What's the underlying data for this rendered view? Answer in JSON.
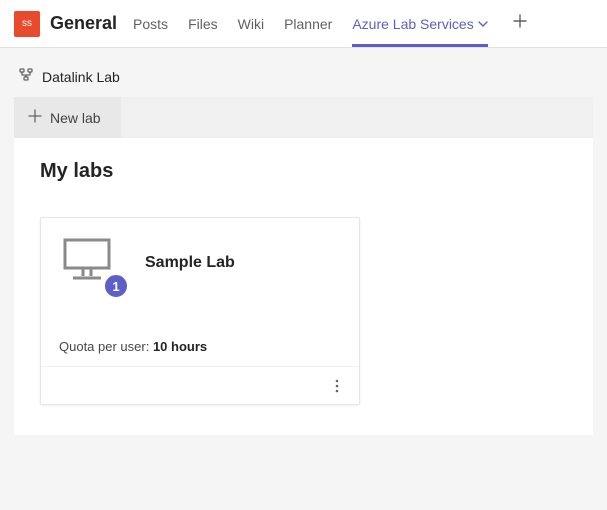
{
  "header": {
    "avatar_initials": "ss",
    "team_name": "General",
    "tabs": [
      {
        "label": "Posts"
      },
      {
        "label": "Files"
      },
      {
        "label": "Wiki"
      },
      {
        "label": "Planner"
      },
      {
        "label": "Azure Lab Services",
        "active": true,
        "has_dropdown": true
      }
    ]
  },
  "breadcrumb": {
    "lab_account": "Datalink Lab"
  },
  "toolbar": {
    "new_lab_label": "New lab"
  },
  "section": {
    "title": "My labs"
  },
  "lab_card": {
    "name": "Sample Lab",
    "vm_count": "1",
    "quota_prefix": "Quota per user: ",
    "quota_value": "10 hours"
  }
}
